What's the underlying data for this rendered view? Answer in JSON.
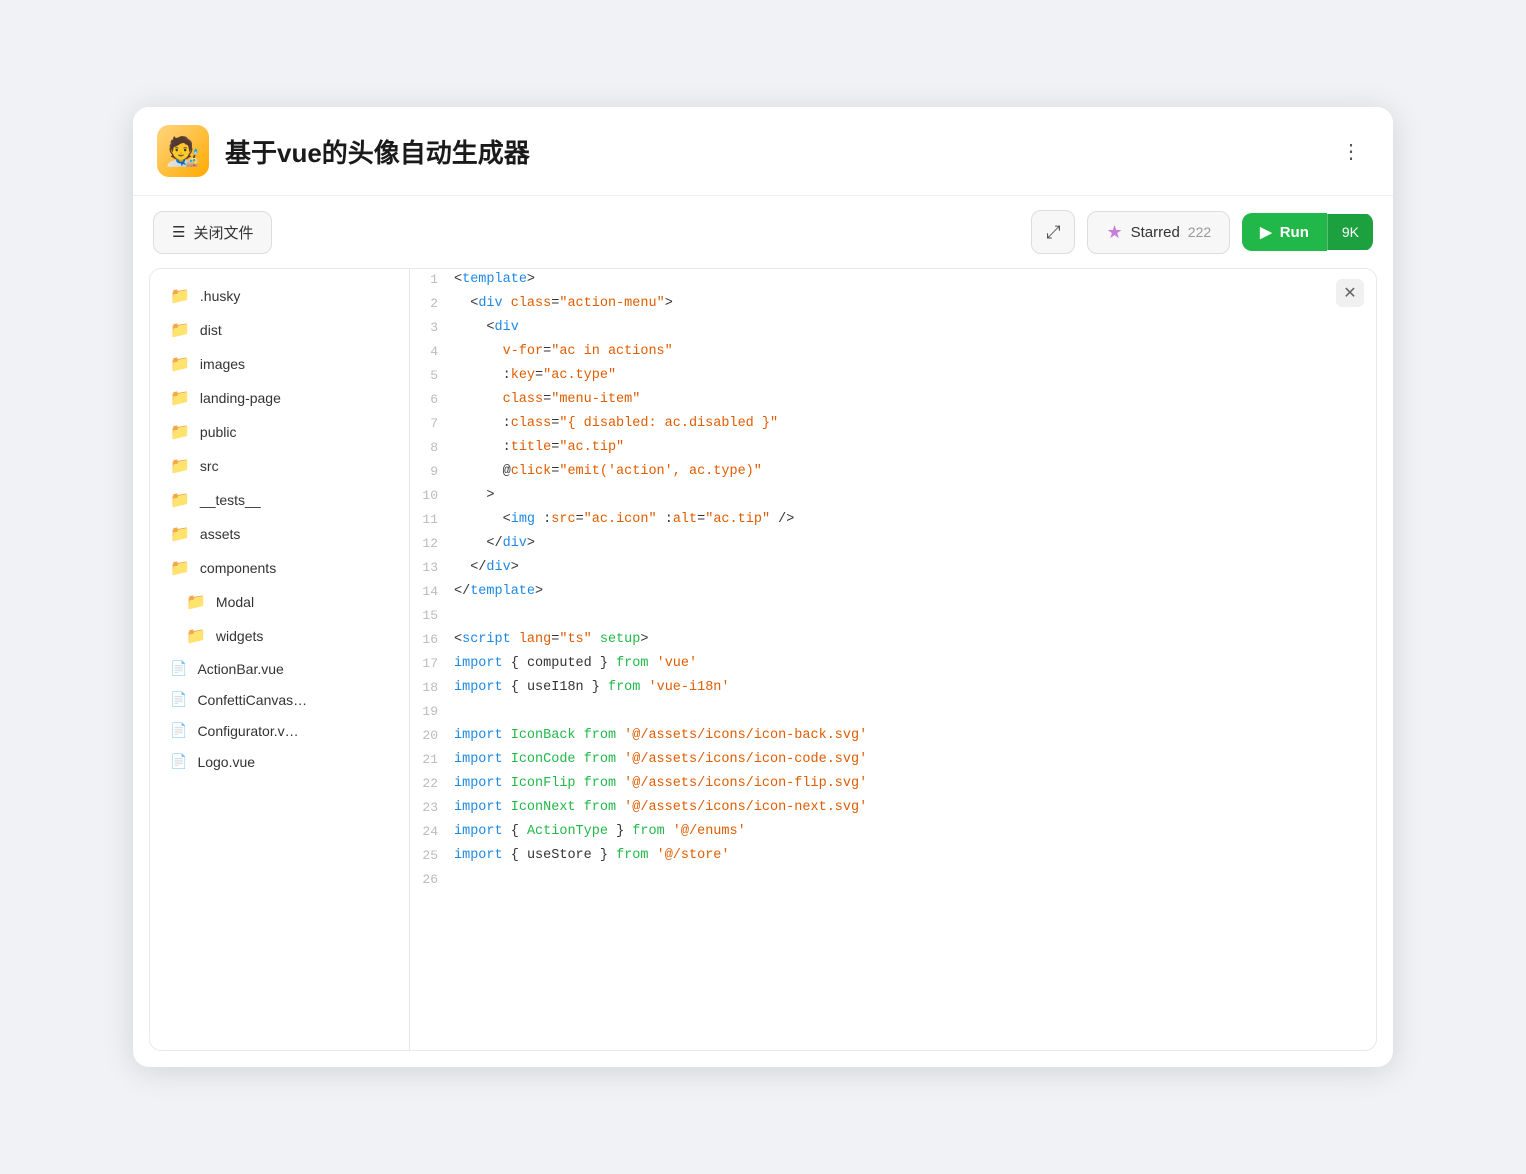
{
  "header": {
    "title": "基于vue的头像自动生成器",
    "avatar_emoji": "🧑‍🎨",
    "more_label": "⋮"
  },
  "toolbar": {
    "close_files_label": "关闭文件",
    "expand_label": "⤢",
    "starred_label": "Starred",
    "starred_count": "222",
    "run_label": "Run",
    "run_count": "9K"
  },
  "sidebar": {
    "items": [
      {
        "id": "husky",
        "label": ".husky",
        "type": "folder",
        "indent": 0
      },
      {
        "id": "dist",
        "label": "dist",
        "type": "folder",
        "indent": 0
      },
      {
        "id": "images",
        "label": "images",
        "type": "folder",
        "indent": 0
      },
      {
        "id": "landing-page",
        "label": "landing-page",
        "type": "folder",
        "indent": 0
      },
      {
        "id": "public",
        "label": "public",
        "type": "folder",
        "indent": 0
      },
      {
        "id": "src",
        "label": "src",
        "type": "folder",
        "indent": 0
      },
      {
        "id": "tests",
        "label": "__tests__",
        "type": "folder",
        "indent": 0
      },
      {
        "id": "assets",
        "label": "assets",
        "type": "folder",
        "indent": 0
      },
      {
        "id": "components",
        "label": "components",
        "type": "folder",
        "indent": 0
      },
      {
        "id": "Modal",
        "label": "Modal",
        "type": "folder",
        "indent": 1
      },
      {
        "id": "widgets",
        "label": "widgets",
        "type": "folder",
        "indent": 1
      },
      {
        "id": "ActionBar",
        "label": "ActionBar.vue",
        "type": "file",
        "indent": 0
      },
      {
        "id": "ConfettiCanvas",
        "label": "ConfettiCanvas…",
        "type": "file",
        "indent": 0
      },
      {
        "id": "Configurator",
        "label": "Configurator.v…",
        "type": "file",
        "indent": 0
      },
      {
        "id": "Logo",
        "label": "Logo.vue",
        "type": "file",
        "indent": 0
      }
    ]
  },
  "code": {
    "lines": [
      {
        "num": 1,
        "html": "<span class='c-bracket'>&lt;</span><span class='c-tag'>template</span><span class='c-bracket'>&gt;</span>"
      },
      {
        "num": 2,
        "html": "  <span class='c-bracket'>&lt;</span><span class='c-tag'>div</span> <span class='c-attr'>class</span>=<span class='c-string'>\"action-menu\"</span><span class='c-bracket'>&gt;</span>"
      },
      {
        "num": 3,
        "html": "    <span class='c-bracket'>&lt;</span><span class='c-tag'>div</span>"
      },
      {
        "num": 4,
        "html": "      <span class='c-attr'>v-for</span>=<span class='c-string'>\"ac in actions\"</span>"
      },
      {
        "num": 5,
        "html": "      <span class='c-bracket'>:</span><span class='c-attr'>key</span>=<span class='c-string'>\"ac.type\"</span>"
      },
      {
        "num": 6,
        "html": "      <span class='c-attr'>class</span>=<span class='c-string'>\"menu-item\"</span>"
      },
      {
        "num": 7,
        "html": "      <span class='c-bracket'>:</span><span class='c-attr'>class</span>=<span class='c-string'>\"{ disabled: ac.disabled }\"</span>"
      },
      {
        "num": 8,
        "html": "      <span class='c-bracket'>:</span><span class='c-attr'>title</span>=<span class='c-string'>\"ac.tip\"</span>"
      },
      {
        "num": 9,
        "html": "      <span class='c-bracket'>@</span><span class='c-attr'>click</span>=<span class='c-string'>\"emit('action', ac.type)\"</span>"
      },
      {
        "num": 10,
        "html": "    <span class='c-bracket'>&gt;</span>"
      },
      {
        "num": 11,
        "html": "      <span class='c-bracket'>&lt;</span><span class='c-tag'>img</span> <span class='c-bracket'>:</span><span class='c-attr'>src</span>=<span class='c-string'>\"ac.icon\"</span> <span class='c-bracket'>:</span><span class='c-attr'>alt</span>=<span class='c-string'>\"ac.tip\"</span> <span class='c-bracket'>/&gt;</span>"
      },
      {
        "num": 12,
        "html": "    <span class='c-bracket'>&lt;/</span><span class='c-tag'>div</span><span class='c-bracket'>&gt;</span>"
      },
      {
        "num": 13,
        "html": "  <span class='c-bracket'>&lt;/</span><span class='c-tag'>div</span><span class='c-bracket'>&gt;</span>"
      },
      {
        "num": 14,
        "html": "<span class='c-bracket'>&lt;/</span><span class='c-tag'>template</span><span class='c-bracket'>&gt;</span>"
      },
      {
        "num": 15,
        "html": ""
      },
      {
        "num": 16,
        "html": "<span class='c-bracket'>&lt;</span><span class='c-tag'>script</span> <span class='c-attr'>lang</span>=<span class='c-module'>\"ts\"</span> <span class='c-green'>setup</span><span class='c-bracket'>&gt;</span>"
      },
      {
        "num": 17,
        "html": "<span class='c-import'>import</span> <span class='c-bracket'>{</span> <span class='c-text'>computed</span> <span class='c-bracket'>}</span> <span class='c-green'>from</span> <span class='c-module'>'vue'</span>"
      },
      {
        "num": 18,
        "html": "<span class='c-import'>import</span> <span class='c-bracket'>{</span> <span class='c-text'>useI18n</span> <span class='c-bracket'>}</span> <span class='c-green'>from</span> <span class='c-module'>'vue-i18n'</span>"
      },
      {
        "num": 19,
        "html": ""
      },
      {
        "num": 20,
        "html": "<span class='c-import'>import</span> <span class='c-green'>IconBack</span> <span class='c-green'>from</span> <span class='c-module'>'@/assets/icons/icon-back.svg'</span>"
      },
      {
        "num": 21,
        "html": "<span class='c-import'>import</span> <span class='c-green'>IconCode</span> <span class='c-green'>from</span> <span class='c-module'>'@/assets/icons/icon-code.svg'</span>"
      },
      {
        "num": 22,
        "html": "<span class='c-import'>import</span> <span class='c-green'>IconFlip</span> <span class='c-green'>from</span> <span class='c-module'>'@/assets/icons/icon-flip.svg'</span>"
      },
      {
        "num": 23,
        "html": "<span class='c-import'>import</span> <span class='c-green'>IconNext</span> <span class='c-green'>from</span> <span class='c-module'>'@/assets/icons/icon-next.svg'</span>"
      },
      {
        "num": 24,
        "html": "<span class='c-import'>import</span> <span class='c-bracket'>{</span> <span class='c-green'>ActionType</span> <span class='c-bracket'>}</span> <span class='c-green'>from</span> <span class='c-module'>'@/enums'</span>"
      },
      {
        "num": 25,
        "html": "<span class='c-import'>import</span> <span class='c-bracket'>{</span> <span class='c-text'>useStore</span> <span class='c-bracket'>}</span> <span class='c-green'>from</span> <span class='c-module'>'@/store'</span>"
      },
      {
        "num": 26,
        "html": ""
      }
    ]
  }
}
